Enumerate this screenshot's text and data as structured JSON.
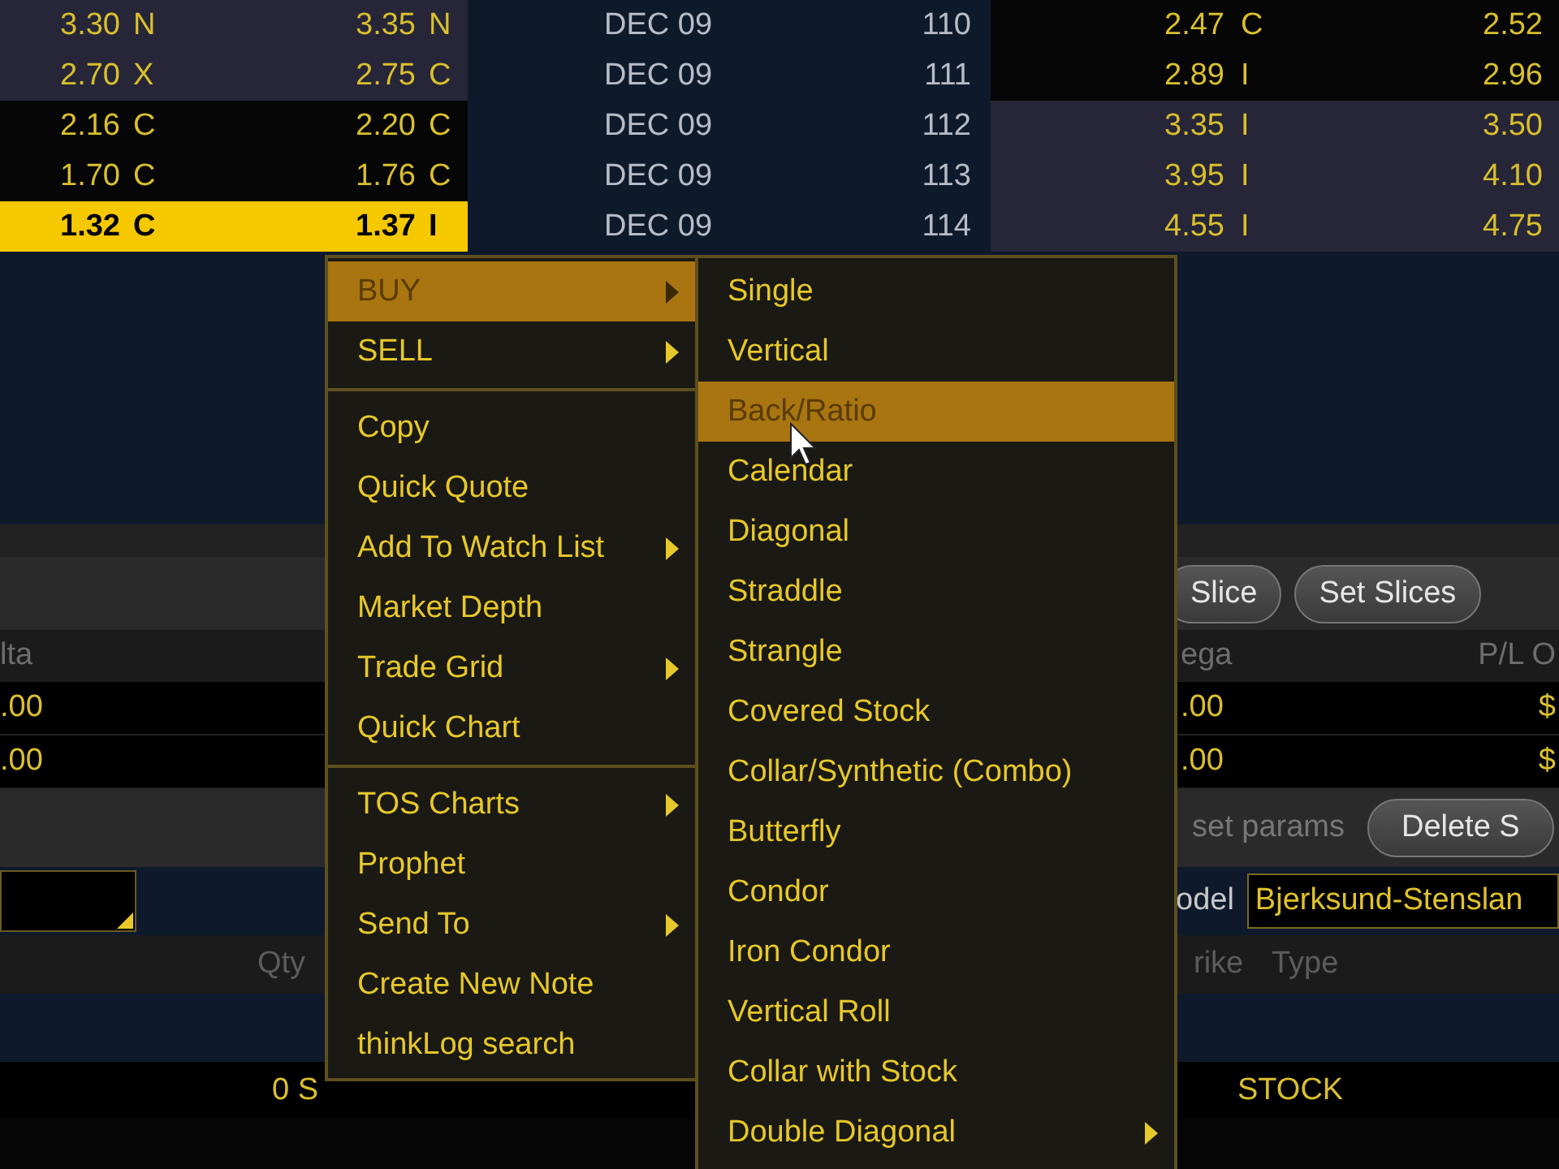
{
  "option_chain": {
    "rows": [
      {
        "selected": false,
        "cells": [
          "3.30",
          "N",
          "3.35",
          "N",
          "DEC 09",
          "110",
          "2.47",
          "C",
          "2.52"
        ]
      },
      {
        "selected": false,
        "cells": [
          "2.70",
          "X",
          "2.75",
          "C",
          "DEC 09",
          "111",
          "2.89",
          "I",
          "2.96"
        ]
      },
      {
        "selected": false,
        "cells": [
          "2.16",
          "C",
          "2.20",
          "C",
          "DEC 09",
          "112",
          "3.35",
          "I",
          "3.50"
        ]
      },
      {
        "selected": false,
        "cells": [
          "1.70",
          "C",
          "1.76",
          "C",
          "DEC 09",
          "113",
          "3.95",
          "I",
          "4.10"
        ]
      },
      {
        "selected": true,
        "cells": [
          "1.32",
          "C",
          "1.37",
          "I",
          "DEC 09",
          "114",
          "4.55",
          "I",
          "4.75"
        ]
      }
    ]
  },
  "toolbar": {
    "buttons": [
      "Slice",
      "Set Slices"
    ]
  },
  "positions": {
    "columns": [
      "lta",
      "ega",
      "P/L O"
    ],
    "rows": [
      [
        ".00",
        ".00",
        "$"
      ],
      [
        ".00",
        ".00",
        "$"
      ]
    ]
  },
  "params_bar": {
    "label": "set params",
    "button": "Delete S"
  },
  "model": {
    "label": "odel",
    "value": "Bjerksund-Stenslan"
  },
  "orders": {
    "columns": [
      "Qty",
      "rike",
      "Type"
    ],
    "rows": [
      [
        "0 S",
        "",
        "STOCK"
      ]
    ]
  },
  "context_menu": {
    "groups": [
      [
        {
          "label": "BUY",
          "submenu": true,
          "selected": true
        },
        {
          "label": "SELL",
          "submenu": true,
          "selected": false
        }
      ],
      [
        {
          "label": "Copy",
          "submenu": false,
          "selected": false
        },
        {
          "label": "Quick Quote",
          "submenu": false,
          "selected": false
        },
        {
          "label": "Add To Watch List",
          "submenu": true,
          "selected": false
        },
        {
          "label": "Market Depth",
          "submenu": false,
          "selected": false
        },
        {
          "label": "Trade Grid",
          "submenu": true,
          "selected": false
        },
        {
          "label": "Quick Chart",
          "submenu": false,
          "selected": false
        }
      ],
      [
        {
          "label": "TOS Charts",
          "submenu": true,
          "selected": false
        },
        {
          "label": "Prophet",
          "submenu": false,
          "selected": false
        },
        {
          "label": "Send To",
          "submenu": true,
          "selected": false
        },
        {
          "label": "Create New Note",
          "submenu": false,
          "selected": false
        },
        {
          "label": "thinkLog search",
          "submenu": false,
          "selected": false
        }
      ]
    ]
  },
  "submenu": {
    "items": [
      {
        "label": "Single",
        "submenu": false,
        "selected": false
      },
      {
        "label": "Vertical",
        "submenu": false,
        "selected": false
      },
      {
        "label": "Back/Ratio",
        "submenu": false,
        "selected": true
      },
      {
        "label": "Calendar",
        "submenu": false,
        "selected": false
      },
      {
        "label": "Diagonal",
        "submenu": false,
        "selected": false
      },
      {
        "label": "Straddle",
        "submenu": false,
        "selected": false
      },
      {
        "label": "Strangle",
        "submenu": false,
        "selected": false
      },
      {
        "label": "Covered Stock",
        "submenu": false,
        "selected": false
      },
      {
        "label": "Collar/Synthetic (Combo)",
        "submenu": false,
        "selected": false
      },
      {
        "label": "Butterfly",
        "submenu": false,
        "selected": false
      },
      {
        "label": "Condor",
        "submenu": false,
        "selected": false
      },
      {
        "label": "Iron Condor",
        "submenu": false,
        "selected": false
      },
      {
        "label": "Vertical Roll",
        "submenu": false,
        "selected": false
      },
      {
        "label": "Collar with Stock",
        "submenu": false,
        "selected": false
      },
      {
        "label": "Double Diagonal",
        "submenu": true,
        "selected": false
      }
    ]
  }
}
